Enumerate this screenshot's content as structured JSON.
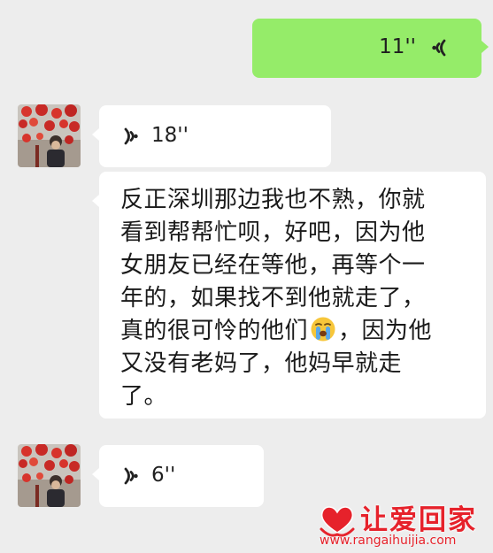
{
  "chat": {
    "messages": [
      {
        "direction": "sent",
        "type": "voice",
        "duration": "11''"
      },
      {
        "direction": "received",
        "type": "voice",
        "duration": "18''"
      },
      {
        "direction": "received",
        "type": "text",
        "lines": [
          "反正深圳那边我也不熟，你就",
          "看到帮帮忙呗，好吧，因为他",
          "女朋友已经在等他，再等个一",
          "年的，如果找不到他就走了，",
          "真的很可怜的他们",
          "，因为他",
          "又没有老妈了，他妈早就走",
          "了。"
        ],
        "emoji": "crying-face"
      },
      {
        "direction": "received",
        "type": "voice",
        "duration": "6''"
      }
    ]
  },
  "watermark": {
    "title": "让爱回家",
    "url": "www.rangaihuijia.com"
  },
  "colors": {
    "background": "#ededed",
    "sent_bubble": "#95ec69",
    "received_bubble": "#ffffff",
    "watermark": "#e6222b"
  },
  "icons": {
    "voice": "voice-wave-icon",
    "avatar": "user-avatar-photo",
    "emoji": "crying-face-emoji",
    "logo": "heart-hands-logo"
  }
}
